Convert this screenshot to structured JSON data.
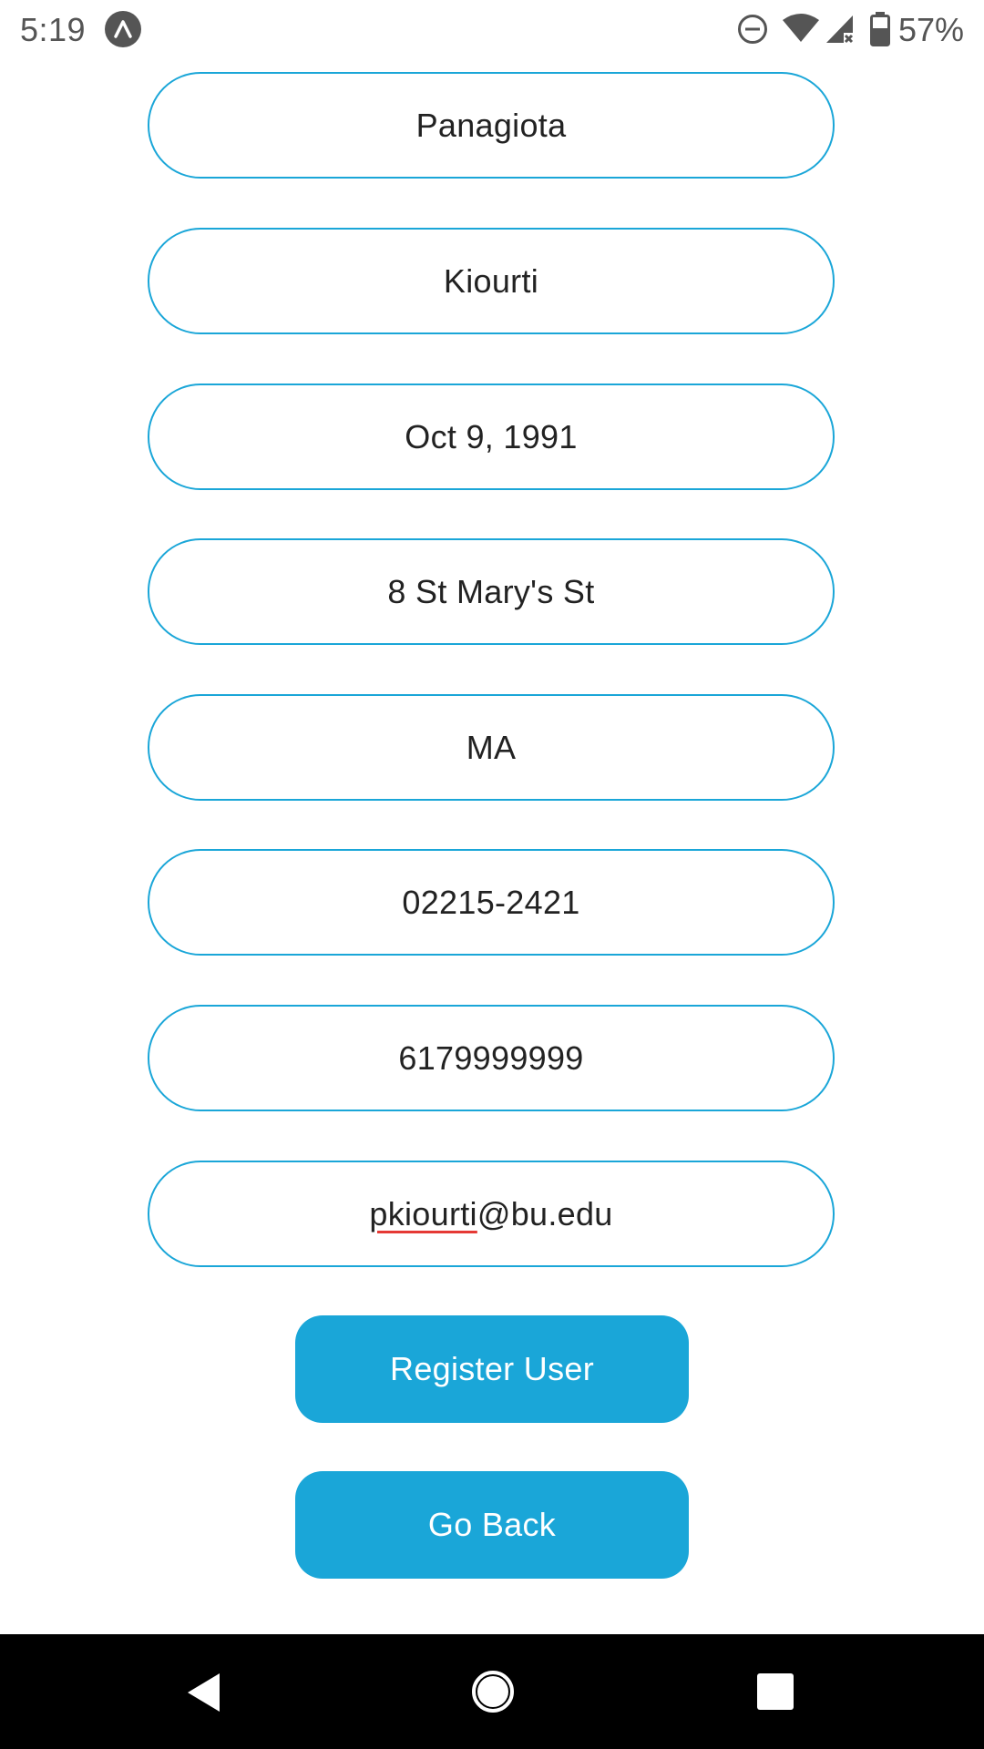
{
  "status_bar": {
    "time": "5:19",
    "battery_percent": "57%",
    "icons": [
      "app-notification-icon",
      "do-not-disturb-icon",
      "wifi-icon",
      "cell-signal-icon",
      "battery-icon"
    ]
  },
  "form": {
    "fields": [
      {
        "name": "first-name",
        "value": "Panagiota"
      },
      {
        "name": "last-name",
        "value": "Kiourti"
      },
      {
        "name": "date-of-birth",
        "value": "Oct 9, 1991"
      },
      {
        "name": "street-address",
        "value": "8 St Mary's St"
      },
      {
        "name": "state",
        "value": "MA"
      },
      {
        "name": "zip-code",
        "value": "02215-2421"
      },
      {
        "name": "phone",
        "value": "6179999999"
      }
    ],
    "email": {
      "misspelled_part": "pkiourti",
      "rest": "@bu.edu"
    },
    "register_label": "Register User",
    "back_label": "Go Back"
  },
  "nav_bar": {
    "icons": [
      "back-icon",
      "home-icon",
      "recents-icon"
    ]
  },
  "colors": {
    "accent": "#1aa6d8",
    "spellcheck": "#e53935",
    "nav_background": "#000000"
  }
}
